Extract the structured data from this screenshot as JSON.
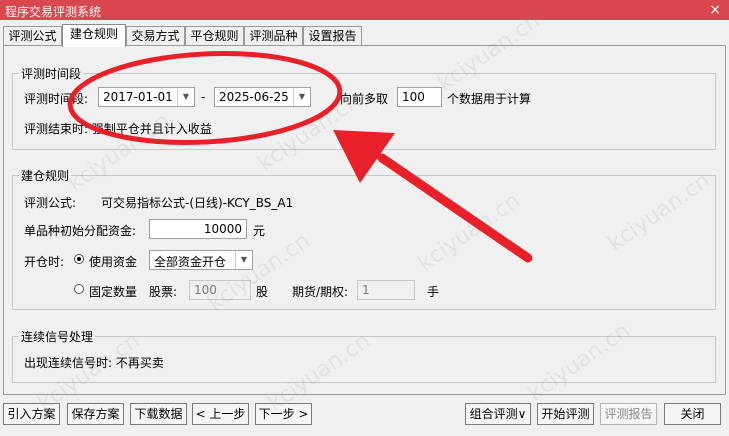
{
  "window": {
    "title": "程序交易评测系统",
    "close_label": "×"
  },
  "tabs": [
    {
      "label": "评测公式"
    },
    {
      "label": "建仓规则"
    },
    {
      "label": "交易方式"
    },
    {
      "label": "平仓规则"
    },
    {
      "label": "评测品种"
    },
    {
      "label": "设置报告"
    }
  ],
  "period": {
    "legend": "评测时间段",
    "label": "评测时间段:",
    "start_date": "2017-01-01",
    "dash": "-",
    "end_date": "2025-06-25",
    "lookback_prefix": "向前多取",
    "lookback_value": "100",
    "lookback_suffix": "个数据用于计算",
    "end_rule": "评测结束时: 强制平仓并且计入收益"
  },
  "open": {
    "legend": "建仓规则",
    "formula_label": "评测公式:",
    "formula_value": "可交易指标公式-(日线)-KCY_BS_A1",
    "capital_label": "单品种初始分配资金:",
    "capital_value": "10000",
    "capital_unit": "元",
    "open_label": "开仓时:",
    "use_capital_label": "使用资金",
    "capital_mode_value": "全部资金开仓",
    "fixed_qty_label": "固定数量",
    "shares_label": "股票:",
    "shares_value": "100",
    "shares_unit": "股",
    "futures_label": "期货/期权:",
    "futures_value": "1",
    "futures_unit": "手"
  },
  "signal": {
    "legend": "连续信号处理",
    "text": "出现连续信号时: 不再买卖"
  },
  "buttons": {
    "import": "引入方案",
    "save": "保存方案",
    "download": "下载数据",
    "prev": "< 上一步",
    "next": "下一步 >",
    "combo": "组合评测∨",
    "start": "开始评测",
    "report": "评测报告",
    "close": "关闭"
  },
  "watermark": "kciyuan.cn",
  "colors": {
    "titlebar": "#d9484e",
    "annotation": "#e8202a"
  }
}
